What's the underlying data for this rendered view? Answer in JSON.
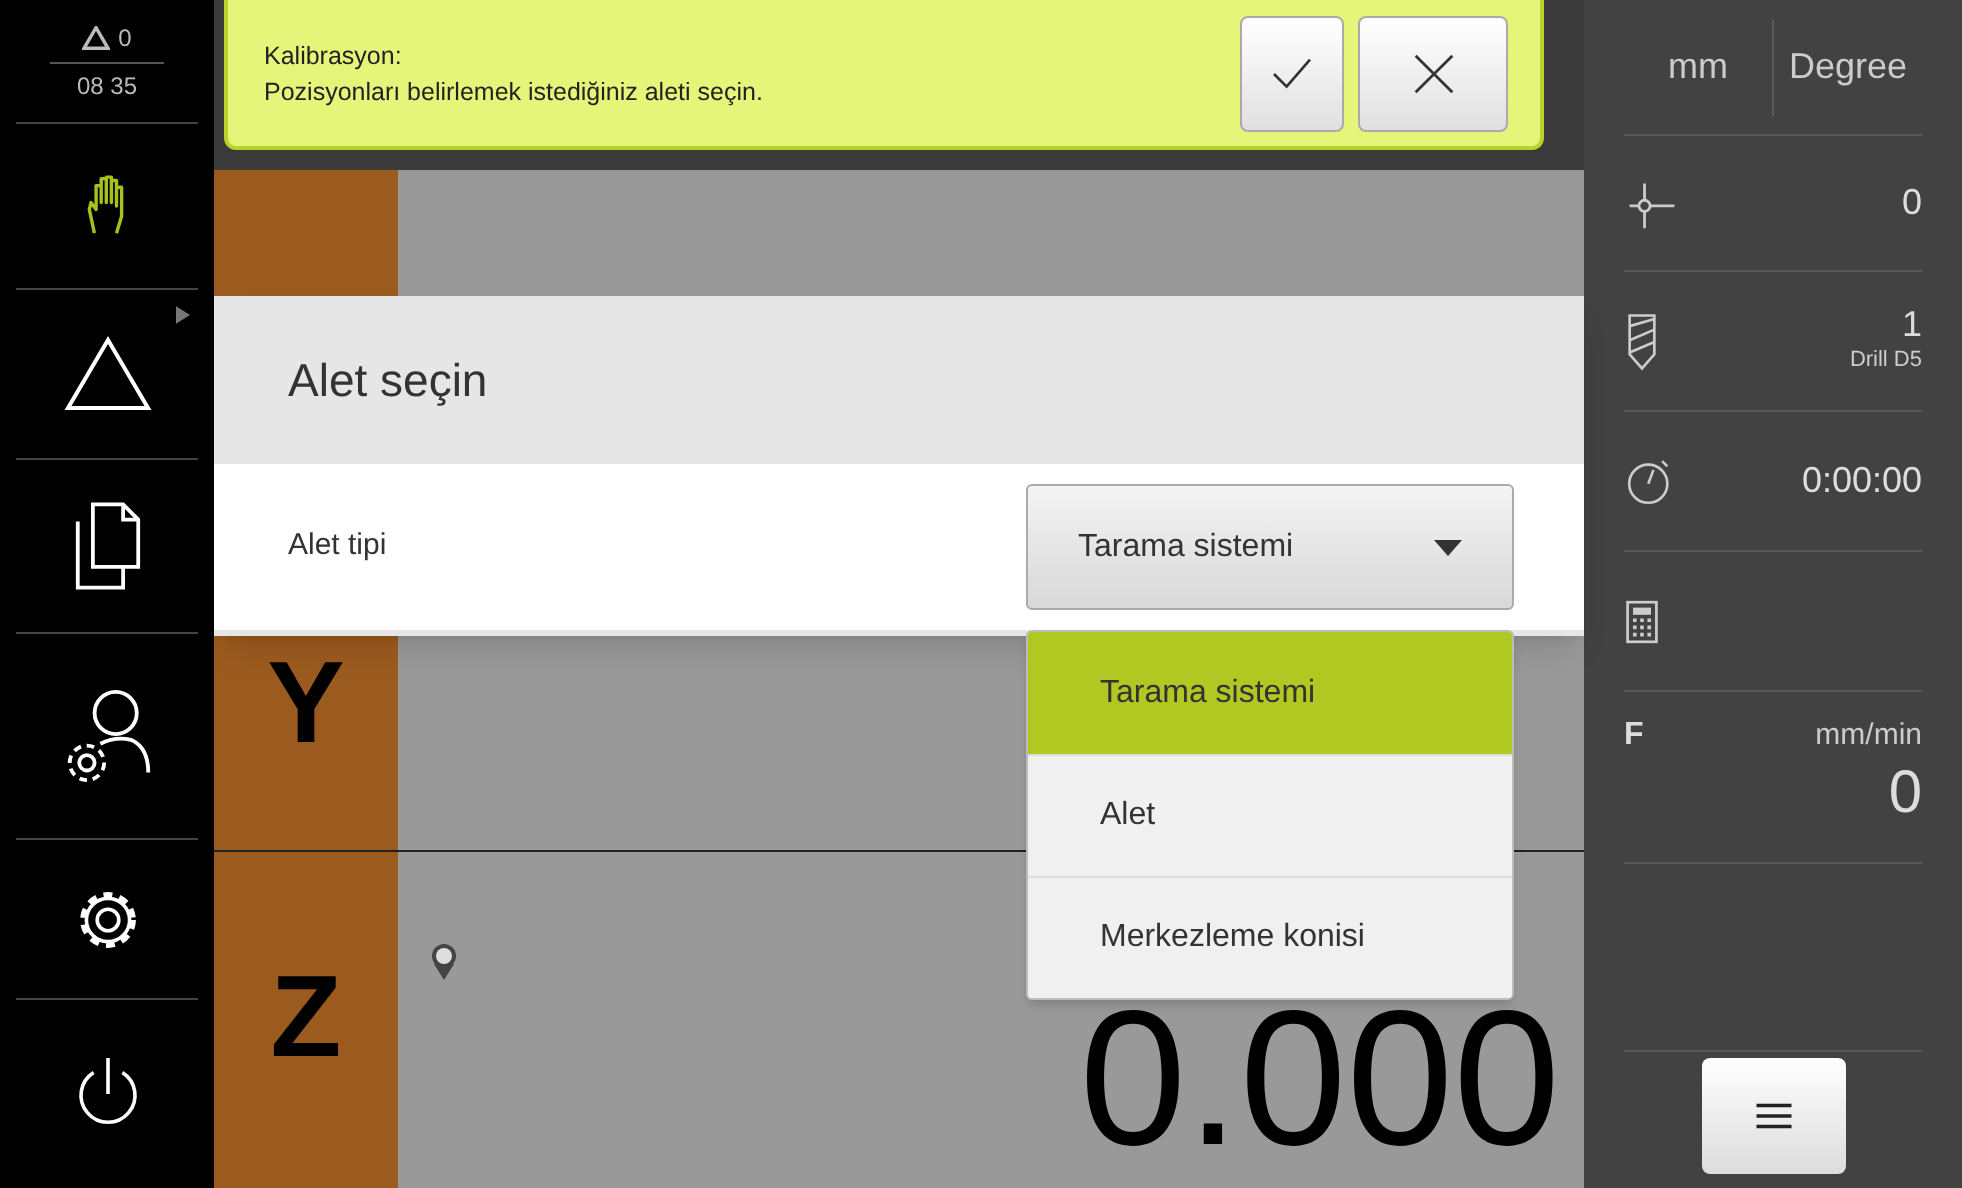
{
  "status": {
    "warnings": "0",
    "time": "08 35"
  },
  "sidebar": {
    "items": [
      {
        "kind": "manual",
        "selected": true
      },
      {
        "kind": "mdi",
        "selected": false
      },
      {
        "kind": "files",
        "selected": false
      },
      {
        "kind": "user",
        "selected": false
      },
      {
        "kind": "settings",
        "selected": false
      },
      {
        "kind": "power",
        "selected": false
      }
    ]
  },
  "message": {
    "title": "Kalibrasyon:",
    "text": "Pozisyonları belirlemek istediğiniz aleti seçin."
  },
  "axes": [
    {
      "label": "Y"
    },
    {
      "label": "Z",
      "value": "0.000",
      "reference": true
    }
  ],
  "dialog": {
    "title": "Alet seçin",
    "field_label": "Alet tipi",
    "value": "Tarama sistemi",
    "options": [
      {
        "label": "Tarama sistemi",
        "selected": true
      },
      {
        "label": "Alet",
        "selected": false
      },
      {
        "label": "Merkezleme konisi",
        "selected": false
      }
    ]
  },
  "right_panel": {
    "units": [
      "mm",
      "Degree"
    ],
    "datum": "0",
    "tool_number": "1",
    "tool_name": "Drill D5",
    "timer": "0:00:00",
    "feed_label": "F",
    "feed_unit": "mm/min",
    "feed_value": "0"
  }
}
